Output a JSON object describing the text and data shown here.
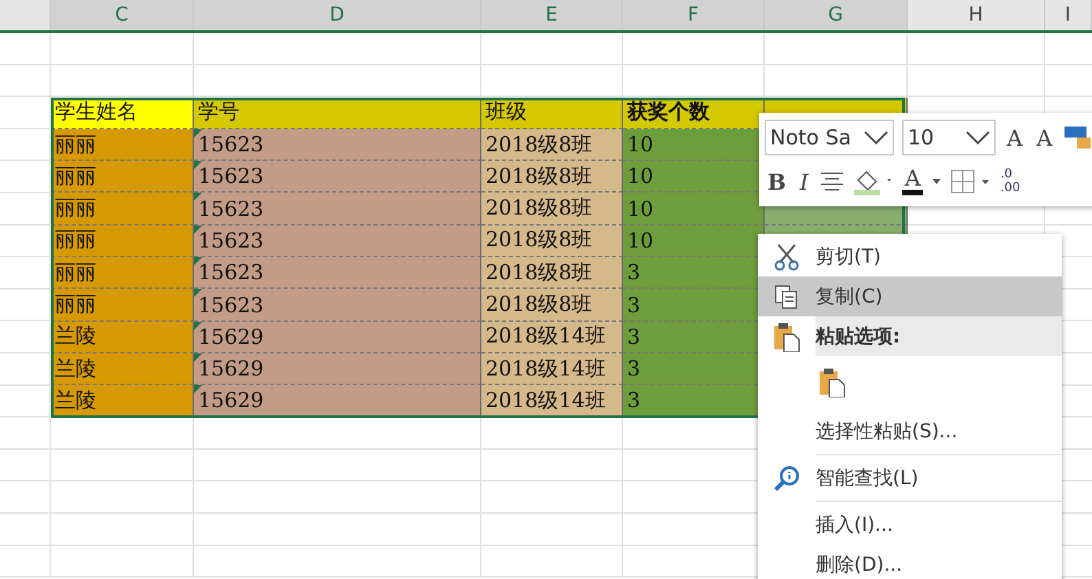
{
  "columns": [
    "C",
    "D",
    "E",
    "F",
    "G",
    "H",
    "I"
  ],
  "table": {
    "headers": [
      "学生姓名",
      "学号",
      "班级",
      "获奖个数"
    ],
    "rows": [
      [
        "丽丽",
        "15623",
        "2018级8班",
        "10"
      ],
      [
        "丽丽",
        "15623",
        "2018级8班",
        "10"
      ],
      [
        "丽丽",
        "15623",
        "2018级8班",
        "10"
      ],
      [
        "丽丽",
        "15623",
        "2018级8班",
        "10"
      ],
      [
        "丽丽",
        "15623",
        "2018级8班",
        "3"
      ],
      [
        "丽丽",
        "15623",
        "2018级8班",
        "3"
      ],
      [
        "兰陵",
        "15629",
        "2018级14班",
        "3"
      ],
      [
        "兰陵",
        "15629",
        "2018级14班",
        "3"
      ],
      [
        "兰陵",
        "15629",
        "2018级14班",
        "3"
      ]
    ]
  },
  "mini_toolbar": {
    "font": "Noto Sa",
    "size": "10",
    "grow": "A",
    "shrink": "A",
    "bold": "B",
    "italic": "I",
    "font_color": "A",
    "decimal": [
      ".0",
      ".00"
    ]
  },
  "context_menu": [
    {
      "kind": "item",
      "label": "剪切(T)",
      "selected": false
    },
    {
      "kind": "item",
      "label": "复制(C)",
      "selected": true
    },
    {
      "kind": "header",
      "label": "粘贴选项:"
    },
    {
      "kind": "paste",
      "selected": false
    },
    {
      "kind": "item",
      "label": "选择性粘贴(S)...",
      "selected": false
    },
    {
      "kind": "separator"
    },
    {
      "kind": "item",
      "label": "智能查找(L)",
      "selected": false
    },
    {
      "kind": "separator"
    },
    {
      "kind": "item",
      "label": "插入(I)...",
      "selected": false
    },
    {
      "kind": "item",
      "label": "删除(D)...",
      "selected": false
    }
  ]
}
